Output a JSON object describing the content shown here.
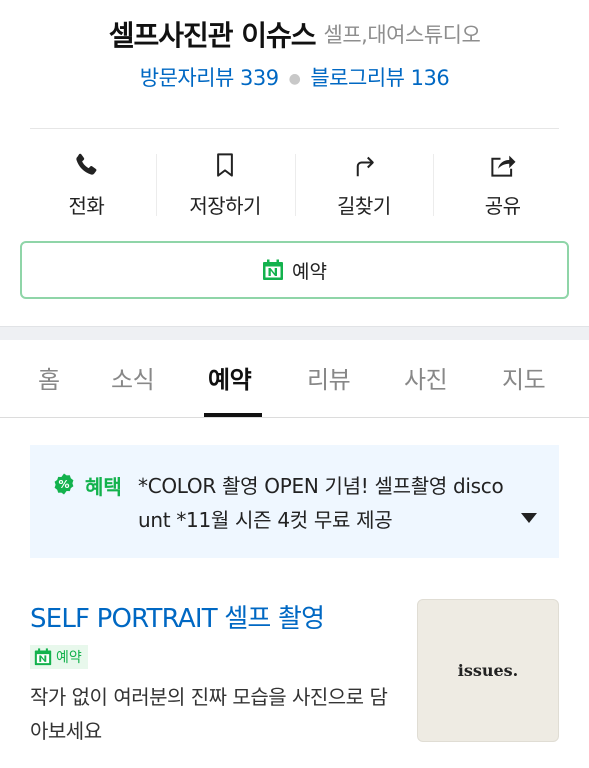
{
  "header": {
    "shop_name": "셀프사진관 이슈스",
    "category": "셀프,대여스튜디오",
    "visitor_reviews": "방문자리뷰 339",
    "blog_reviews": "블로그리뷰 136"
  },
  "actions": [
    {
      "label": "전화",
      "icon": "phone-icon"
    },
    {
      "label": "저장하기",
      "icon": "bookmark-icon"
    },
    {
      "label": "길찾기",
      "icon": "directions-icon"
    },
    {
      "label": "공유",
      "icon": "share-icon"
    }
  ],
  "reserve_button": {
    "label": "예약",
    "icon": "naver-calendar-icon"
  },
  "tabs": [
    {
      "label": "홈"
    },
    {
      "label": "소식"
    },
    {
      "label": "예약",
      "active": true
    },
    {
      "label": "리뷰"
    },
    {
      "label": "사진"
    },
    {
      "label": "지도"
    }
  ],
  "benefit": {
    "tag": "혜택",
    "text": "*COLOR 촬영 OPEN 기념! 셀프촬영 discount *11월 시즌 4컷 무료 제공",
    "icon": "percent-badge-icon"
  },
  "product": {
    "title": "SELF PORTRAIT 셀프 촬영",
    "badge": "예약",
    "description": "작가 없이 여러분의 진짜 모습을 사진으로 담아보세요",
    "thumbnail_text": "issues."
  },
  "colors": {
    "link_blue": "#0068c3",
    "naver_green": "#13b24d",
    "benefit_bg": "#eff7ff"
  }
}
